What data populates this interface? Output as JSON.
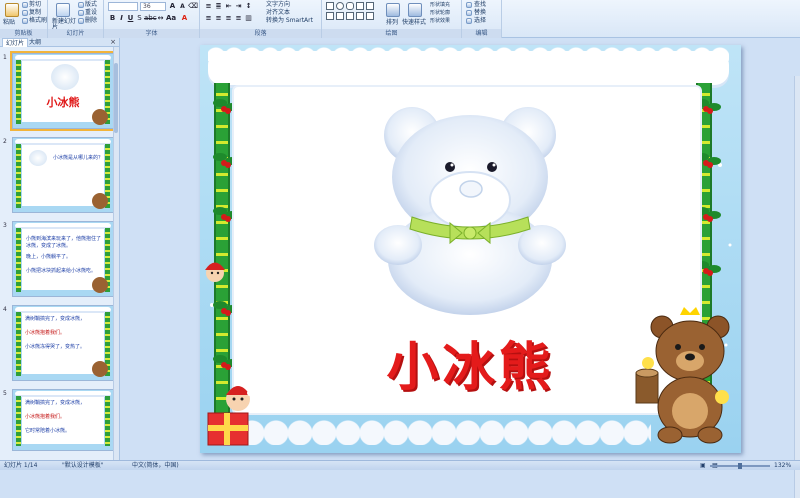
{
  "ribbon": {
    "clipboard": {
      "paste": "粘贴",
      "cut": "剪切",
      "copy": "复制",
      "format_painter": "格式刷",
      "group_label": "剪贴板"
    },
    "slides": {
      "new_slide": "新建幻灯片",
      "layout": "版式",
      "reset": "重设",
      "delete": "删除",
      "group_label": "幻灯片"
    },
    "font": {
      "size": "36",
      "group_label": "字体"
    },
    "paragraph": {
      "text_direction": "文字方向",
      "align_text": "对齐文本",
      "convert_smartart": "转换为 SmartArt",
      "group_label": "段落"
    },
    "drawing": {
      "arrange": "排列",
      "quick_styles": "快速样式",
      "shape_fill": "形状填充",
      "shape_outline": "形状轮廓",
      "shape_effects": "形状效果",
      "group_label": "绘图"
    },
    "editing": {
      "find": "查找",
      "replace": "替换",
      "select": "选择",
      "group_label": "编辑"
    }
  },
  "pane": {
    "tabs": [
      "幻灯片",
      "大纲"
    ],
    "close": "×",
    "thumbnails": [
      {
        "num": "1",
        "title": "小冰熊"
      },
      {
        "num": "2",
        "text": "小冰熊是从哪儿来的？"
      },
      {
        "num": "3",
        "lines": [
          "小熊到海滨来玩来了，他熊抱住了冰熊，变成了冰熊。",
          "晚上，小熊躺平了。",
          "小熊把冰块抓起来给小冰熊吃。"
        ]
      },
      {
        "num": "4",
        "lines": [
          "满树鞘搞完了，变成冰熊，",
          "小冰熊抱着我们。",
          "小冰熊冻得哭了，变热了。"
        ]
      },
      {
        "num": "5",
        "lines": [
          "满树鞘搞完了，变成冰熊，",
          "小冰熊抱着我们。",
          "它时常陪着小冰熊。"
        ]
      }
    ]
  },
  "slide": {
    "title": "小冰熊"
  },
  "status": {
    "slide_count": "幻灯片 1/14",
    "theme": "\"默认设计模板\"",
    "language": "中文(简体，中国)",
    "zoom": "132%"
  },
  "colors": {
    "title_red": "#e41b1b",
    "pillar_green": "#2aa136",
    "sky_blue": "#9ad2f0",
    "ribbon_bg": "#dbe7f7"
  }
}
